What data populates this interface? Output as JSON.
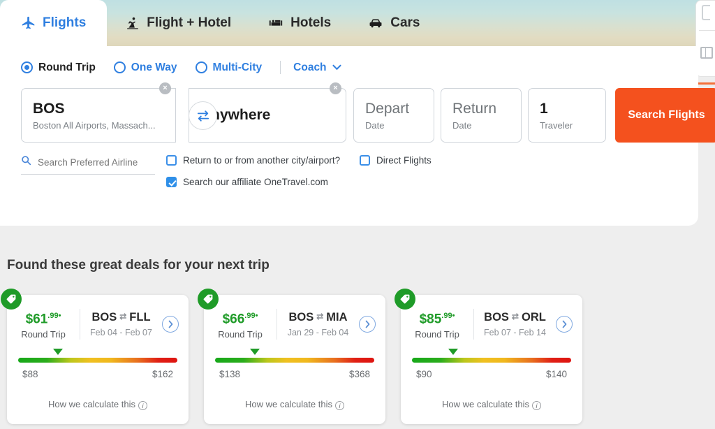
{
  "tabs": [
    {
      "label": "Flights",
      "icon": "airplane-icon",
      "active": true
    },
    {
      "label": "Flight + Hotel",
      "icon": "flight-hotel-icon",
      "active": false
    },
    {
      "label": "Hotels",
      "icon": "bed-icon",
      "active": false
    },
    {
      "label": "Cars",
      "icon": "car-icon",
      "active": false
    }
  ],
  "trip_types": [
    {
      "label": "Round Trip",
      "selected": true
    },
    {
      "label": "One Way",
      "selected": false
    },
    {
      "label": "Multi-City",
      "selected": false
    }
  ],
  "cabin": {
    "label": "Coach",
    "icon": "chevron-down-icon"
  },
  "form": {
    "origin": {
      "code": "BOS",
      "detail": "Boston All Airports, Massach...",
      "clear": "×"
    },
    "destination": {
      "value": "Anywhere",
      "clear": "×"
    },
    "depart": {
      "value": "Depart",
      "sub": "Date"
    },
    "return": {
      "value": "Return",
      "sub": "Date"
    },
    "travelers": {
      "count": "1",
      "label": "Traveler"
    },
    "swap_icon": "swap-arrows-icon",
    "search_button": "Search Flights"
  },
  "options": {
    "airline_placeholder": "Search Preferred Airline",
    "airline_value": "",
    "checkboxes": [
      {
        "label": "Return to or from another city/airport?",
        "checked": false
      },
      {
        "label": "Direct Flights",
        "checked": false
      },
      {
        "label": "Search our affiliate OneTravel.com",
        "checked": true
      }
    ]
  },
  "deals": {
    "heading": "Found these great deals for your next trip",
    "how_calculate": "How we calculate this",
    "cards": [
      {
        "price_whole": "$61",
        "price_cents": ".99",
        "asterisk": "•",
        "trip_type": "Round Trip",
        "origin": "BOS",
        "destination": "FLL",
        "dates": "Feb 04 - Feb 07",
        "gauge_low": "$88",
        "gauge_high": "$162",
        "marker_pct": 25
      },
      {
        "price_whole": "$66",
        "price_cents": ".99",
        "asterisk": "•",
        "trip_type": "Round Trip",
        "origin": "BOS",
        "destination": "MIA",
        "dates": "Jan 29 - Feb 04",
        "gauge_low": "$138",
        "gauge_high": "$368",
        "marker_pct": 25
      },
      {
        "price_whole": "$85",
        "price_cents": ".99",
        "asterisk": "•",
        "trip_type": "Round Trip",
        "origin": "BOS",
        "destination": "ORL",
        "dates": "Feb 07 - Feb 14",
        "gauge_low": "$90",
        "gauge_high": "$140",
        "marker_pct": 26
      }
    ]
  },
  "colors": {
    "accent_blue": "#2f7fe0",
    "search_orange": "#f4511e",
    "deal_green": "#1f9b28",
    "page_bg": "#eeeeee"
  }
}
